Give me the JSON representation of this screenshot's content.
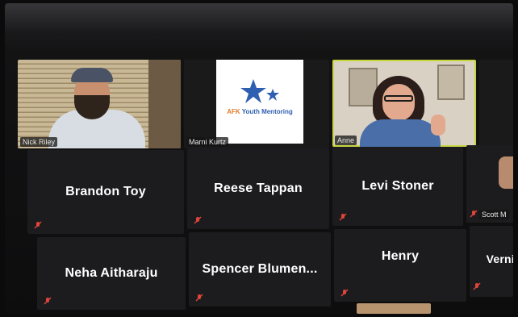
{
  "participants": {
    "row1": [
      {
        "label": "Nick Riley"
      },
      {
        "label": "Marni Kurtz",
        "logo_prefix": "AFK",
        "logo_text": " Youth Mentoring"
      },
      {
        "label": "Anne"
      }
    ],
    "row2": [
      {
        "name": "Brandon Toy"
      },
      {
        "name": "Reese Tappan"
      },
      {
        "name": "Levi Stoner"
      },
      {
        "label": "Scott M"
      }
    ],
    "row3": [
      {
        "name": "Neha Aitharaju"
      },
      {
        "name": "Spencer  Blumen..."
      },
      {
        "name": "Henry"
      },
      {
        "name": "Vernil"
      }
    ]
  },
  "colors": {
    "active_speaker_outline": "#c7d641",
    "mute_icon": "#e0443a",
    "tile_bg": "#1c1c1e",
    "logo_blue": "#2f5fb0",
    "logo_orange": "#e07a2c"
  },
  "icons": {
    "mute": "microphone-muted-icon",
    "logo": "star-logo-icon"
  }
}
